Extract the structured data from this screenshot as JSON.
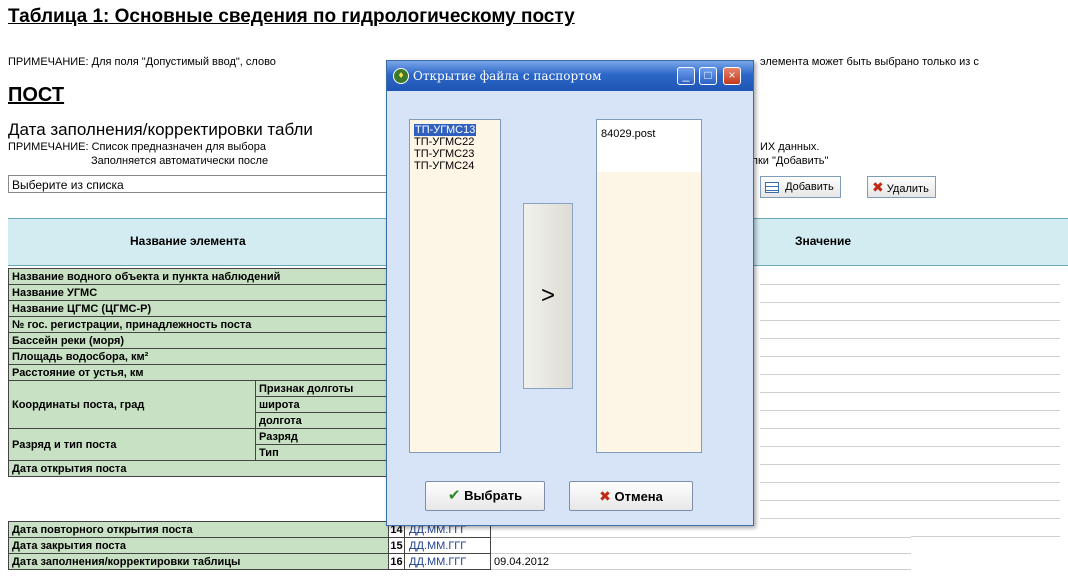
{
  "table_title": "Таблица 1: Основные сведения по гидрологическому посту",
  "note1_left": "ПРИМЕЧАНИЕ: Для поля \"Допустимый ввод\", слово",
  "note1_right": "элемента может быть выбрано только из с",
  "section_title": "ПОСТ",
  "date_heading": "Дата заполнения/корректировки табли",
  "note2_line1_left": "ПРИМЕЧАНИЕ: Список предназначен для выбора",
  "note2_line2_left": "Заполняется автоматически после",
  "note2_line1_right": "ИХ данных.",
  "note2_line2_right": "кнопки \"Добавить\"",
  "select_placeholder": "Выберите из списка",
  "add_button": "Добавить",
  "delete_button": "Удалить",
  "header_element": "Название элемента",
  "header_value": "Значение",
  "rows": {
    "r1": "Название водного объекта и пункта наблюдений",
    "r2": "Название УГМС",
    "r3": "Название ЦГМС (ЦГМС-Р)",
    "r4": "№ гос. регистрации, принадлежность поста",
    "r5": "Бассейн реки (моря)",
    "r6": "Площадь водосбора, км²",
    "r7": "Расстояние от устья, км",
    "r8a": "Координаты поста, град",
    "r8b": "Признак долготы",
    "r8c": "широта",
    "r8d": "долгота",
    "r9a": "Разряд и тип поста",
    "r9b": "Разряд",
    "r9c": "Тип",
    "r10": "Дата открытия поста",
    "r11": "Дата повторного открытия поста",
    "r11n": "14",
    "r11v": "ДД.ММ.ГГГ",
    "r12": "Дата закрытия поста",
    "r12n": "15",
    "r12v": "ДД.ММ.ГГГ",
    "r13": "Дата заполнения/корректировки таблицы",
    "r13n": "16",
    "r13v": "ДД.ММ.ГГГ",
    "r13x": "09.04.2012"
  },
  "dialog": {
    "title": "Открытие файла с паспортом",
    "left_items": [
      "ТП-УГМС13",
      "ТП-УГМС22",
      "ТП-УГМС23",
      "ТП-УГМС24"
    ],
    "right_items": [
      "84029.post"
    ],
    "arrow_label": ">",
    "ok_label": "Выбрать",
    "cancel_label": "Отмена",
    "minimize": "_",
    "maximize": "□",
    "close": "×"
  },
  "colors": {
    "title_bar": "#2c67c8",
    "dialog_bg": "#d7e3f6",
    "table_cell_green": "#c8e0c3",
    "header_band": "#d2ecf2",
    "selected_item": "#2f5fbf"
  }
}
